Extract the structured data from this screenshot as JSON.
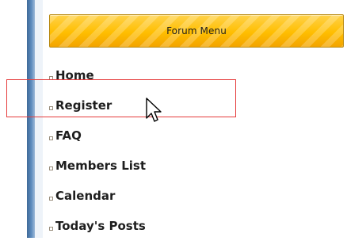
{
  "menu": {
    "title": "Forum Menu",
    "items": [
      {
        "label": "Home"
      },
      {
        "label": "Register"
      },
      {
        "label": "FAQ"
      },
      {
        "label": "Members List"
      },
      {
        "label": "Calendar"
      },
      {
        "label": "Today's Posts"
      }
    ]
  },
  "icons": {
    "bullet": "square-bullet-icon",
    "cursor": "mouse-pointer-icon"
  },
  "colors": {
    "header_gold": "#ffbe00",
    "sidebar_blue": "#4f7aa8",
    "highlight_red": "#e53c3c",
    "text": "#1e1e1e"
  }
}
